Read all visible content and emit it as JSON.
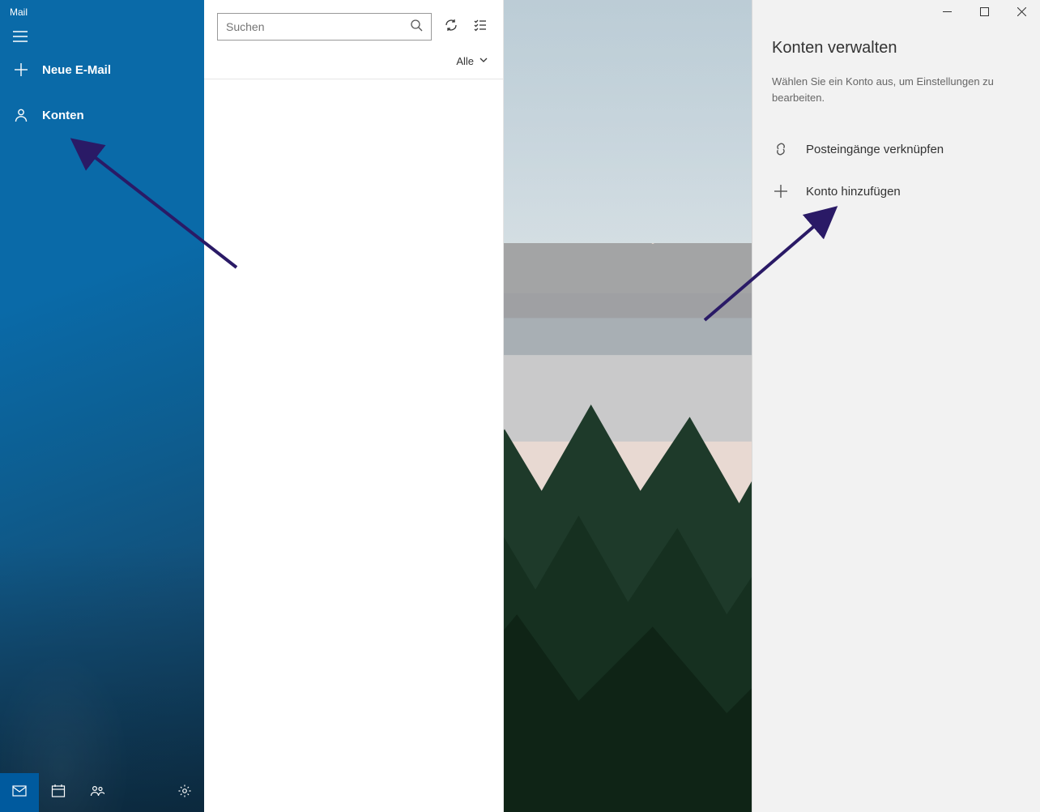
{
  "sidebar": {
    "app_title": "Mail",
    "new_mail_label": "Neue E-Mail",
    "accounts_label": "Konten"
  },
  "search": {
    "placeholder": "Suchen"
  },
  "filter": {
    "label": "Alle"
  },
  "panel": {
    "title": "Konten verwalten",
    "subtitle": "Wählen Sie ein Konto aus, um Einstellungen zu bearbeiten.",
    "link_inboxes_label": "Posteingänge verknüpfen",
    "add_account_label": "Konto hinzufügen"
  }
}
